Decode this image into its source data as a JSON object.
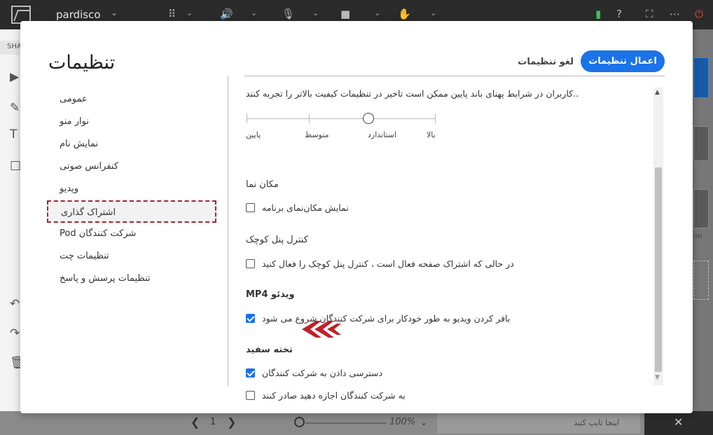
{
  "topbar": {
    "brand": "pardisco"
  },
  "leftbar": {
    "share_label": "SHA"
  },
  "rightbar": {
    "partial_label": "on"
  },
  "bottombar": {
    "page_number": "1",
    "zoom_label": "100%",
    "chat_placeholder": "اینجا تایپ کنید"
  },
  "modal": {
    "title": "تنظیمات",
    "apply_label": "اعمال تنظیمات",
    "cancel_label": "لغو تنظیمات",
    "menu": [
      {
        "label": "عمومی",
        "active": false
      },
      {
        "label": "نوار منو",
        "active": false
      },
      {
        "label": "نمایش نام",
        "active": false
      },
      {
        "label": "کنفرانس صوتی",
        "active": false
      },
      {
        "label": "ویدیو",
        "active": false
      },
      {
        "label": "اشتراک گذاری",
        "active": true
      },
      {
        "label": "Pod شرکت کنندگان",
        "active": false
      },
      {
        "label": "تنظیمات چت",
        "active": false
      },
      {
        "label": "تنظیمات پرسش و پاسخ",
        "active": false
      }
    ],
    "content": {
      "quality_text": "..کاربران در شرایط پهنای باند پایین ممکن است تاخیر در تنظیمات کیفیت بالاتر را تجربه کنند",
      "quality_levels": [
        "پایین",
        "متوسط",
        "استاندارد",
        "بالا"
      ],
      "quality_selected": "استاندارد",
      "cursor_section": "مکان نما",
      "cursor_option": "نمایش مکان‌نمای برنامه",
      "cursor_checked": false,
      "small_panel_section": "کنترل پنل کوچک",
      "small_panel_option": "در حالی که اشتراک صفحه فعال است ، کنترل پنل کوچک را فعال کنید",
      "small_panel_checked": false,
      "mp4_section": "MP4 ویدئو",
      "mp4_option": "بافر کردن ویدیو به طور خودکار برای شرکت کنندگان شروع می شود",
      "mp4_checked": true,
      "whiteboard_section": "تخته سفید",
      "whiteboard_option1": "دسترسی دادن به شرکت کنندگان",
      "whiteboard_option1_checked": true,
      "whiteboard_option2": "به شرکت کنندگان اجازه دهید صادر کنند",
      "whiteboard_option2_checked": false
    }
  },
  "colors": {
    "accent": "#1a73e8",
    "arrow": "#c0202a",
    "active_border": "#a32533"
  }
}
